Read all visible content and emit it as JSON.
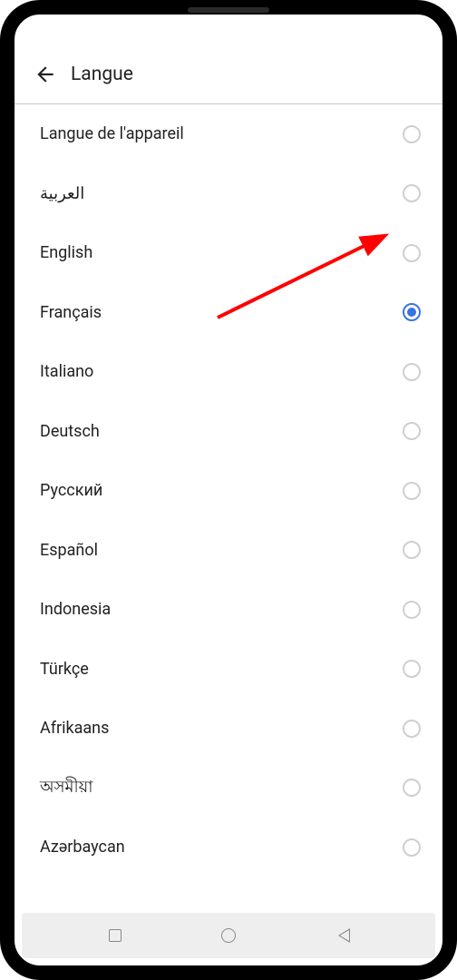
{
  "header": {
    "title": "Langue"
  },
  "languages": [
    {
      "label": "Langue de l'appareil",
      "selected": false
    },
    {
      "label": "العربية",
      "selected": false
    },
    {
      "label": "English",
      "selected": false
    },
    {
      "label": "Français",
      "selected": true
    },
    {
      "label": "Italiano",
      "selected": false
    },
    {
      "label": "Deutsch",
      "selected": false
    },
    {
      "label": "Русский",
      "selected": false
    },
    {
      "label": "Español",
      "selected": false
    },
    {
      "label": "Indonesia",
      "selected": false
    },
    {
      "label": "Türkçe",
      "selected": false
    },
    {
      "label": "Afrikaans",
      "selected": false
    },
    {
      "label": "অসমীয়া",
      "selected": false
    },
    {
      "label": "Azərbaycan",
      "selected": false
    }
  ],
  "annotation": {
    "color": "#ff0000"
  }
}
